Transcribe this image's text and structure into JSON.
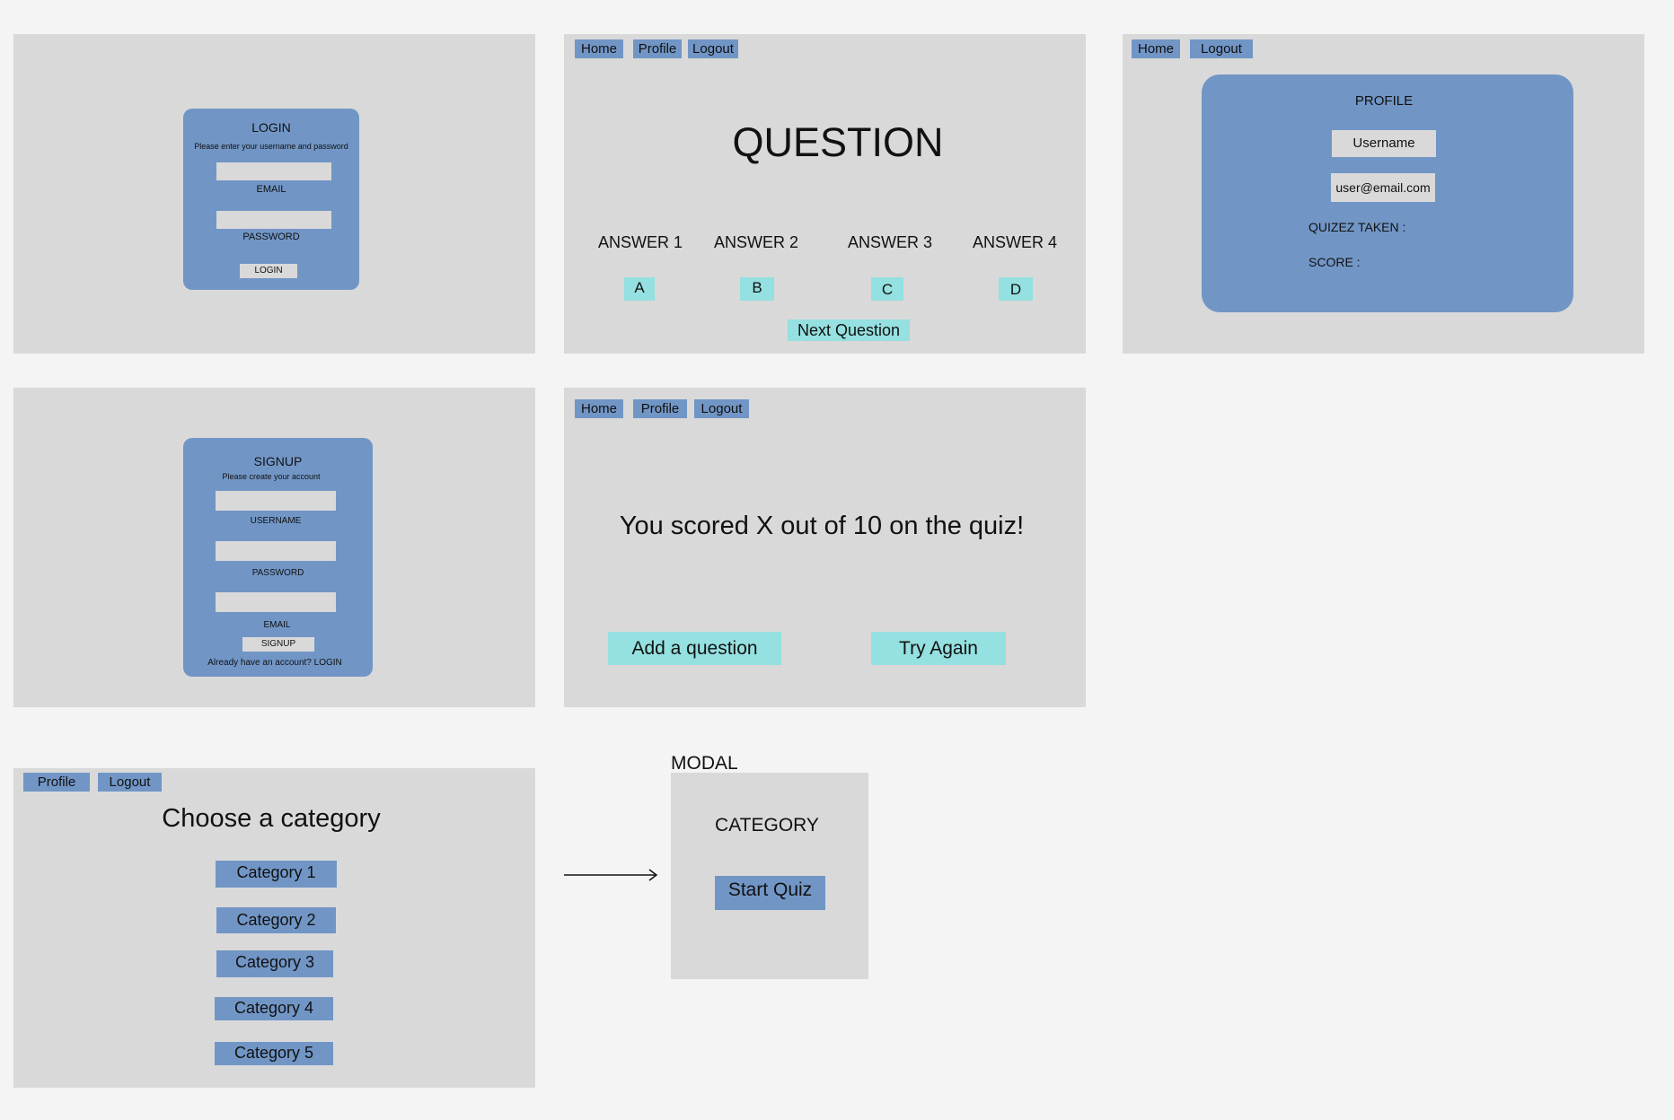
{
  "login": {
    "title": "LOGIN",
    "subtitle": "Please enter your username and password",
    "email_label": "EMAIL",
    "password_label": "PASSWORD",
    "button": "LOGIN"
  },
  "question_screen": {
    "nav": {
      "home": "Home",
      "profile": "Profile",
      "logout": "Logout"
    },
    "title": "QUESTION",
    "answers": [
      "ANSWER 1",
      "ANSWER 2",
      "ANSWER 3",
      "ANSWER 4"
    ],
    "choices": [
      "A",
      "B",
      "C",
      "D"
    ],
    "next": "Next Question"
  },
  "profile_screen": {
    "nav": {
      "home": "Home",
      "logout": "Logout"
    },
    "title": "PROFILE",
    "username": "Username",
    "email": "user@email.com",
    "quizzes_taken": "QUIZEZ TAKEN :",
    "score": "SCORE :"
  },
  "signup": {
    "title": "SIGNUP",
    "subtitle": "Please create your account",
    "username_label": "USERNAME",
    "password_label": "PASSWORD",
    "email_label": "EMAIL",
    "button": "SIGNUP",
    "footer": "Already have an account? LOGIN"
  },
  "results_screen": {
    "nav": {
      "home": "Home",
      "profile": "Profile",
      "logout": "Logout"
    },
    "message": "You scored X out of 10 on the quiz!",
    "add_question": "Add a question",
    "try_again": "Try Again"
  },
  "category_screen": {
    "nav": {
      "profile": "Profile",
      "logout": "Logout"
    },
    "title": "Choose a category",
    "categories": [
      "Category 1",
      "Category 2",
      "Category 3",
      "Category 4",
      "Category 5"
    ]
  },
  "modal": {
    "caption": "MODAL",
    "title": "CATEGORY",
    "button": "Start Quiz"
  },
  "colors": {
    "background": "#f4f4f4",
    "frame": "#d9d9d9",
    "blue": "#7196c6",
    "teal": "#95e0e0"
  },
  "icons": {
    "flow_arrow": "right-arrow-icon"
  }
}
